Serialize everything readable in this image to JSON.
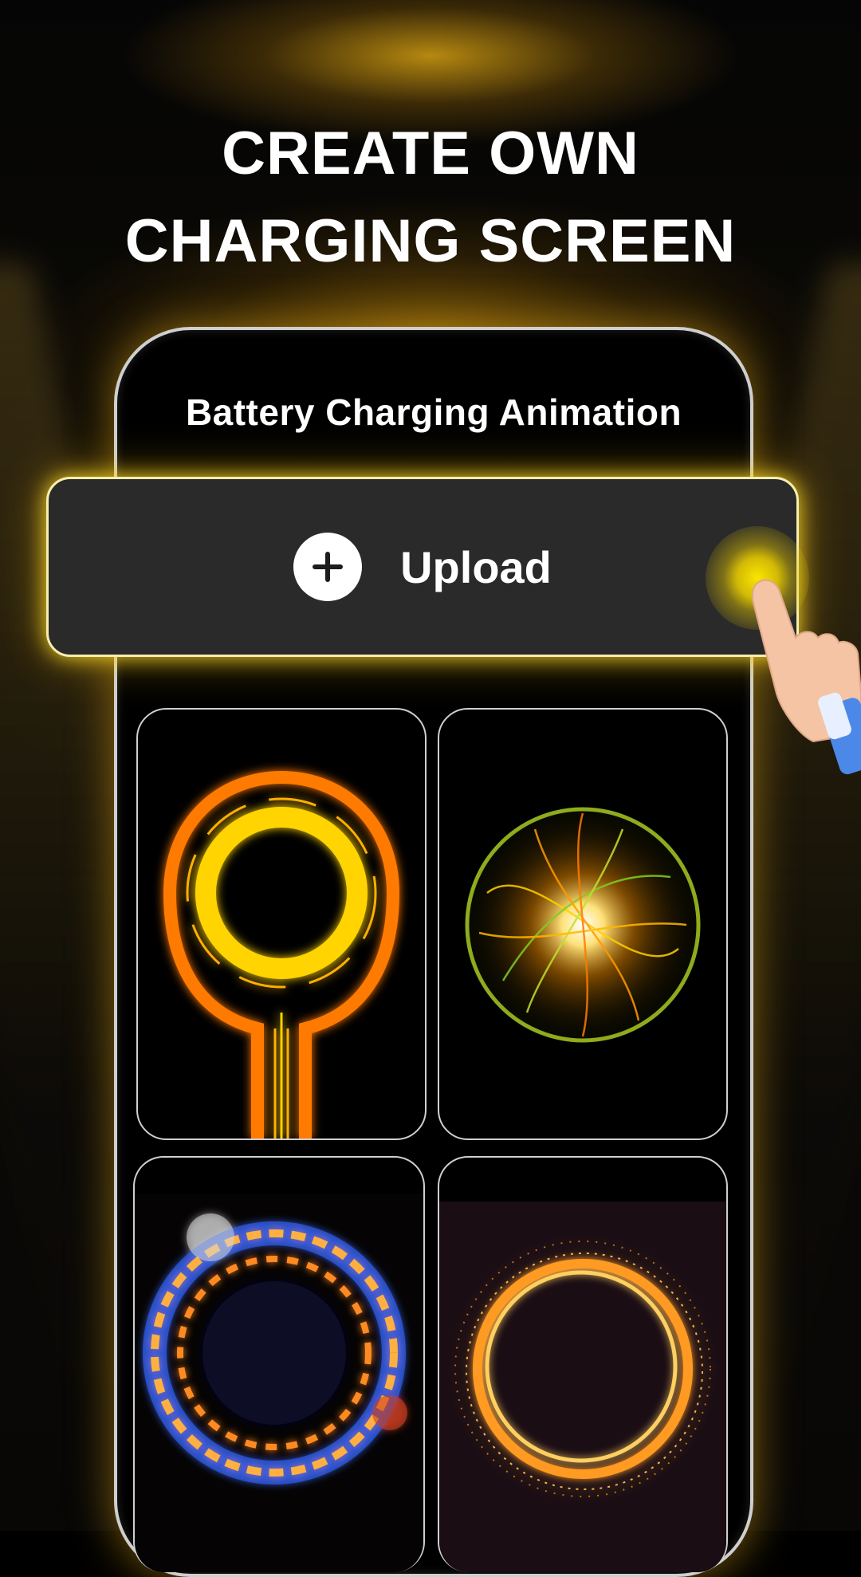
{
  "headline": {
    "line1": "CREATE OWN",
    "line2": "CHARGING SCREEN"
  },
  "phone": {
    "title": "Battery Charging Animation"
  },
  "upload": {
    "label": "Upload",
    "icon": "plus-circle-icon"
  },
  "gallery": {
    "items": [
      {
        "icon": "neon-ring-plug-animation"
      },
      {
        "icon": "energy-sphere-animation"
      },
      {
        "icon": "fire-ring-animation"
      },
      {
        "icon": "golden-ring-animation"
      }
    ]
  },
  "colors": {
    "accent": "#f5d000",
    "card": "#2a2a2a",
    "background": "#000000",
    "text": "#ffffff"
  }
}
